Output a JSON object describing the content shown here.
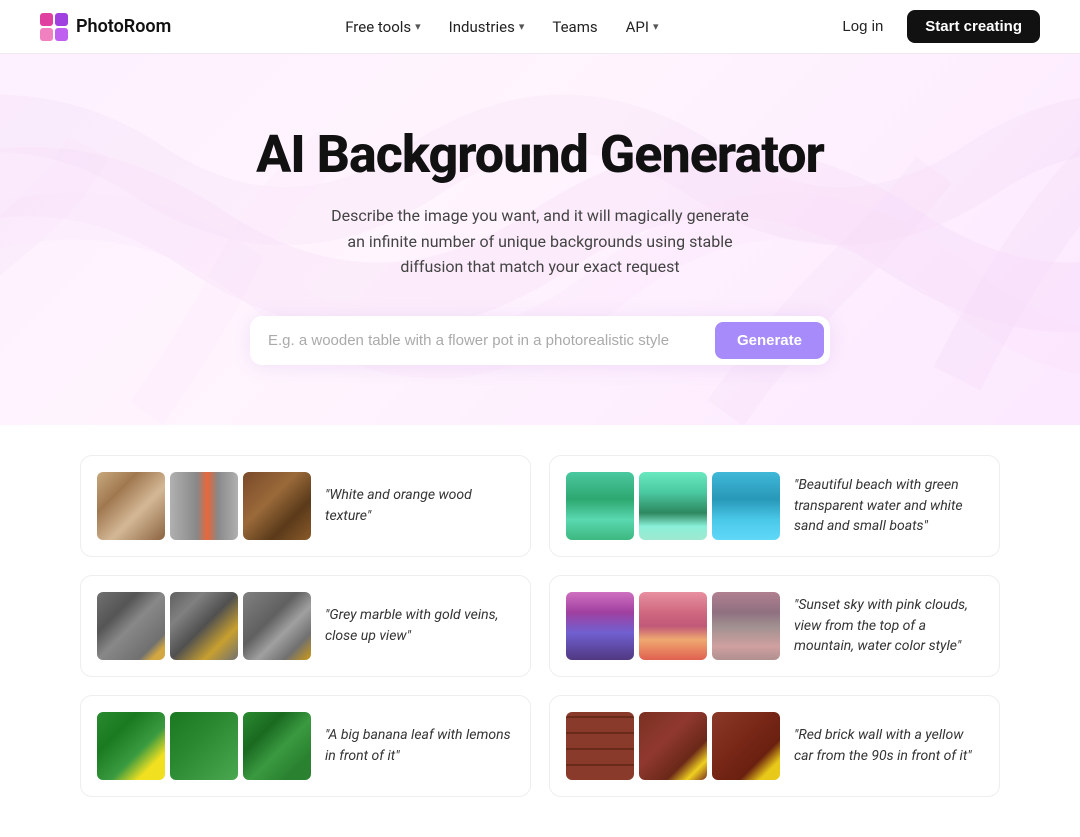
{
  "nav": {
    "logo_text": "PhotoRoom",
    "links": [
      {
        "label": "Free tools",
        "has_dropdown": true
      },
      {
        "label": "Industries",
        "has_dropdown": true
      },
      {
        "label": "Teams",
        "has_dropdown": false
      },
      {
        "label": "API",
        "has_dropdown": true
      }
    ],
    "login_label": "Log in",
    "start_label": "Start creating"
  },
  "hero": {
    "title": "AI Background Generator",
    "subtitle": "Describe the image you want, and it will magically generate an infinite number of unique backgrounds using stable diffusion that match your exact request",
    "input_placeholder": "E.g. a wooden table with a flower pot in a photorealistic style",
    "generate_label": "Generate"
  },
  "gallery": {
    "cards": [
      {
        "caption": "\"White and orange wood texture\""
      },
      {
        "caption": "\"Beautiful beach with green transparent water and white sand and small boats\""
      },
      {
        "caption": "\"Grey marble with gold veins, close up view\""
      },
      {
        "caption": "\"Sunset sky with pink clouds, view from the top of a mountain, water color style\""
      },
      {
        "caption": "\"A big banana leaf with lemons in front of it\""
      },
      {
        "caption": "\"Red brick wall with a yellow car from the 90s in front of it\""
      }
    ]
  }
}
